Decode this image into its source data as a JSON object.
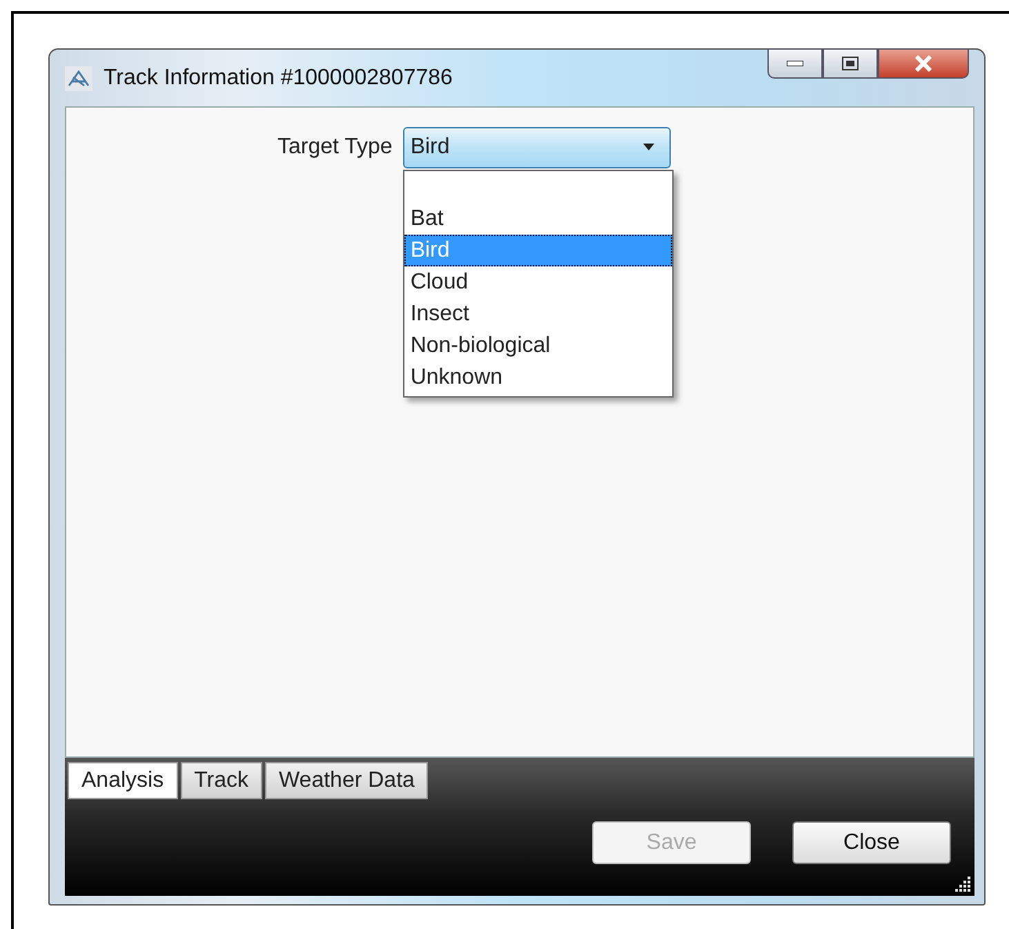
{
  "window": {
    "title": "Track Information #1000002807786"
  },
  "field": {
    "label": "Target Type",
    "value": "Bird",
    "expanded": true
  },
  "options": [
    {
      "label": "Bat",
      "selected": false
    },
    {
      "label": "Bird",
      "selected": true
    },
    {
      "label": "Cloud",
      "selected": false
    },
    {
      "label": "Insect",
      "selected": false
    },
    {
      "label": "Non-biological",
      "selected": false
    },
    {
      "label": "Unknown",
      "selected": false
    }
  ],
  "tabs": [
    {
      "label": "Analysis",
      "selected": true
    },
    {
      "label": "Track",
      "selected": false
    },
    {
      "label": "Weather Data",
      "selected": false
    }
  ],
  "buttons": [
    {
      "label": "Save",
      "disabled": true
    },
    {
      "label": "Close",
      "disabled": false
    }
  ]
}
